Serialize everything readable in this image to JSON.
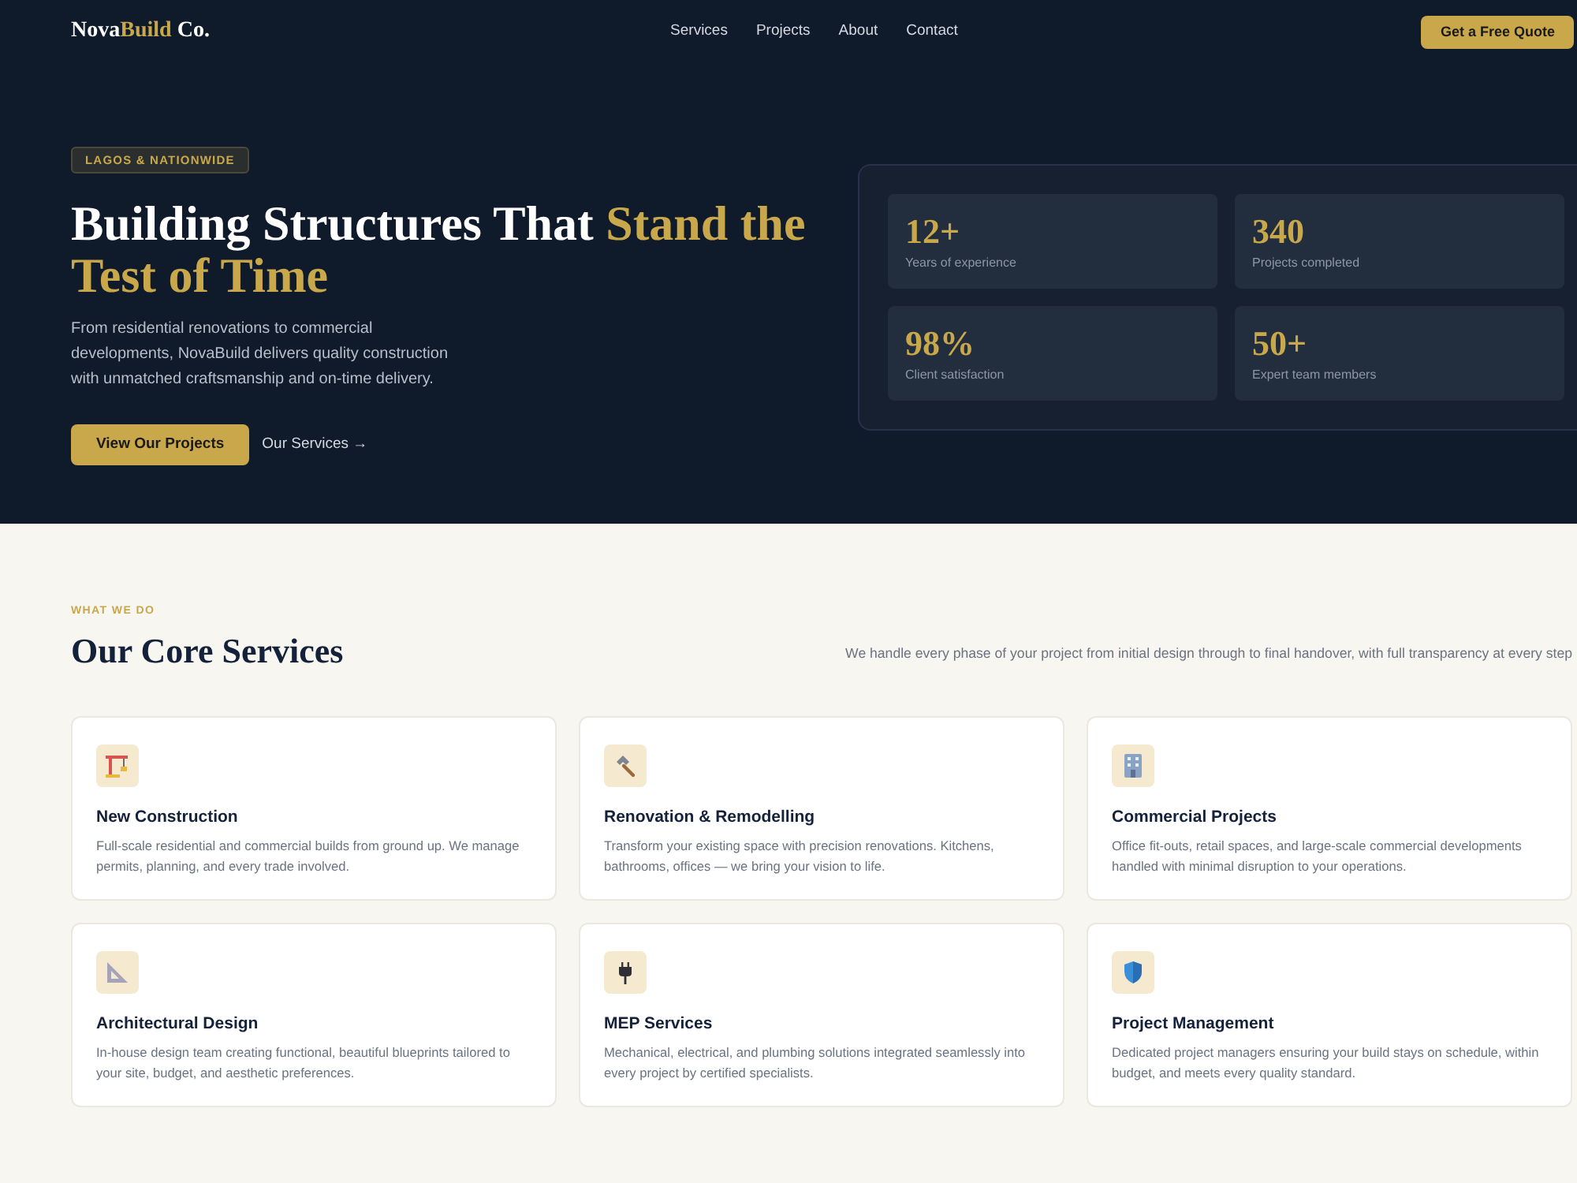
{
  "header": {
    "logo": [
      {
        "text": "Nova",
        "accent": false
      },
      {
        "text": "Build",
        "accent": true
      },
      {
        "text": " Co.",
        "accent": false
      }
    ],
    "nav": [
      "Services",
      "Projects",
      "About",
      "Contact"
    ],
    "cta": "Get a Free Quote"
  },
  "hero": {
    "badge": "LAGOS & NATIONWIDE",
    "headline": [
      {
        "text": "Building Structures That ",
        "accent": false
      },
      {
        "text": "Stand the Test of Time",
        "accent": true
      }
    ],
    "text": "From residential renovations to commercial developments, NovaBuild delivers quality construction with unmatched craftsmanship and on-time delivery.",
    "primary_button": "View Our Projects",
    "secondary_link": "Our Services →",
    "stats": [
      {
        "value": "12+",
        "label": "Years of experience"
      },
      {
        "value": "340",
        "label": "Projects completed"
      },
      {
        "value": "98%",
        "label": "Client satisfaction"
      },
      {
        "value": "50+",
        "label": "Expert team members"
      }
    ]
  },
  "services": {
    "eyebrow": "WHAT WE DO",
    "title": "Our Core Services",
    "intro": "We handle every phase of your project from initial design through to final handover, with full transparency at every step",
    "cards": [
      {
        "title": "New Construction",
        "text": "Full-scale residential and commercial builds from ground up. We manage permits, planning, and every trade involved."
      },
      {
        "title": "Renovation & Remodelling",
        "text": "Transform your existing space with precision renovations. Kitchens, bathrooms, offices — we bring your vision to life."
      },
      {
        "title": "Commercial Projects",
        "text": "Office fit-outs, retail spaces, and large-scale commercial developments handled with minimal disruption to your operations."
      },
      {
        "title": "Architectural Design",
        "text": "In-house design team creating functional, beautiful blueprints tailored to your site, budget, and aesthetic preferences."
      },
      {
        "title": "MEP Services",
        "text": "Mechanical, electrical, and plumbing solutions integrated seamlessly into every project by certified specialists."
      },
      {
        "title": "Project Management",
        "text": "Dedicated project managers ensuring your build stays on schedule, within budget, and meets every quality standard."
      }
    ]
  }
}
